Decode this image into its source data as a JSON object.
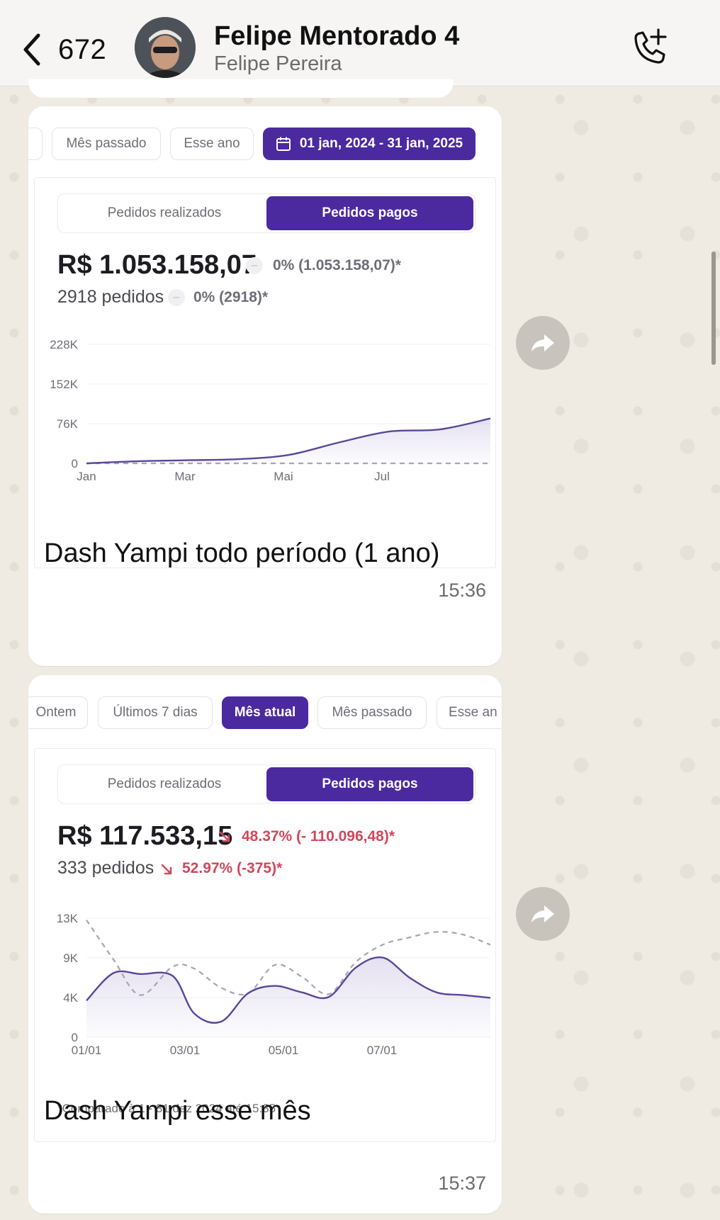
{
  "header": {
    "back_count": "672",
    "title": "Felipe Mentorado 4",
    "subtitle": "Felipe Pereira"
  },
  "messages": [
    {
      "chips": [
        {
          "label": "Mês passado",
          "active": false
        },
        {
          "label": "Esse ano",
          "active": false
        },
        {
          "label": "01 jan, 2024 - 31 jan, 2025",
          "active": true
        }
      ],
      "toggle": {
        "left": "Pedidos realizados",
        "right": "Pedidos pagos"
      },
      "total_value": "R$ 1.053.158,07",
      "total_delta": "0% (1.053.158,07)*",
      "orders": "2918 pedidos",
      "orders_delta": "0% (2918)*",
      "caption": "Dash Yampi todo período (1 ano)",
      "time": "15:36"
    },
    {
      "chips": [
        {
          "label": "Ontem",
          "active": false
        },
        {
          "label": "Últimos 7 dias",
          "active": false
        },
        {
          "label": "Mês atual",
          "active": true
        },
        {
          "label": "Mês passado",
          "active": false
        },
        {
          "label": "Esse an",
          "active": false
        }
      ],
      "toggle": {
        "left": "Pedidos realizados",
        "right": "Pedidos pagos"
      },
      "total_value": "R$ 117.533,15",
      "total_delta": "48.37% (- 110.096,48)*",
      "orders": "333 pedidos",
      "orders_delta": "52.97% (-375)*",
      "footnote": "*Comparado à 1 - 31 dez 2024 até 15:35",
      "caption": "Dash Yampi esse mês",
      "time": "15:37"
    }
  ],
  "colors": {
    "accent": "#4b2aa0",
    "line_current": "#5a4699",
    "line_previous": "#a8a3b5",
    "negative": "#d1475a",
    "wallpaper": "#efeae2"
  },
  "chart_data": [
    {
      "type": "area",
      "title": "",
      "x_ticks": [
        "Jan",
        "Mar",
        "Mai",
        "Jul"
      ],
      "y_ticks": [
        "0",
        "76K",
        "152K",
        "228K"
      ],
      "ylim": [
        0,
        228000
      ],
      "x": [
        0,
        1,
        2,
        3,
        4,
        5,
        6,
        7,
        8
      ],
      "series": [
        {
          "values": [
            0,
            4000,
            6000,
            8000,
            16000,
            40000,
            61000,
            65000,
            86000
          ]
        },
        {
          "values": [
            0,
            0,
            0,
            0,
            0,
            0,
            0,
            0,
            0
          ]
        }
      ]
    },
    {
      "type": "area",
      "title": "",
      "x_ticks": [
        "01/01",
        "03/01",
        "05/01",
        "07/01"
      ],
      "y_ticks": [
        "0",
        "4K",
        "9K",
        "13K"
      ],
      "ylim": [
        0,
        13000
      ],
      "x": [
        0,
        0.5,
        1,
        1.6,
        2,
        2.5,
        3,
        3.5,
        4,
        4.5,
        5,
        5.5,
        6,
        6.5,
        7,
        7.5
      ],
      "series": [
        {
          "values": [
            4000,
            7000,
            6900,
            6700,
            2600,
            1700,
            4800,
            5600,
            4900,
            4400,
            7600,
            8700,
            6500,
            4900,
            4600,
            4300
          ]
        },
        {
          "values": [
            12800,
            8500,
            4600,
            7700,
            7500,
            5400,
            4800,
            7900,
            6600,
            4700,
            8200,
            10100,
            10900,
            11500,
            11200,
            10100
          ]
        }
      ]
    }
  ]
}
